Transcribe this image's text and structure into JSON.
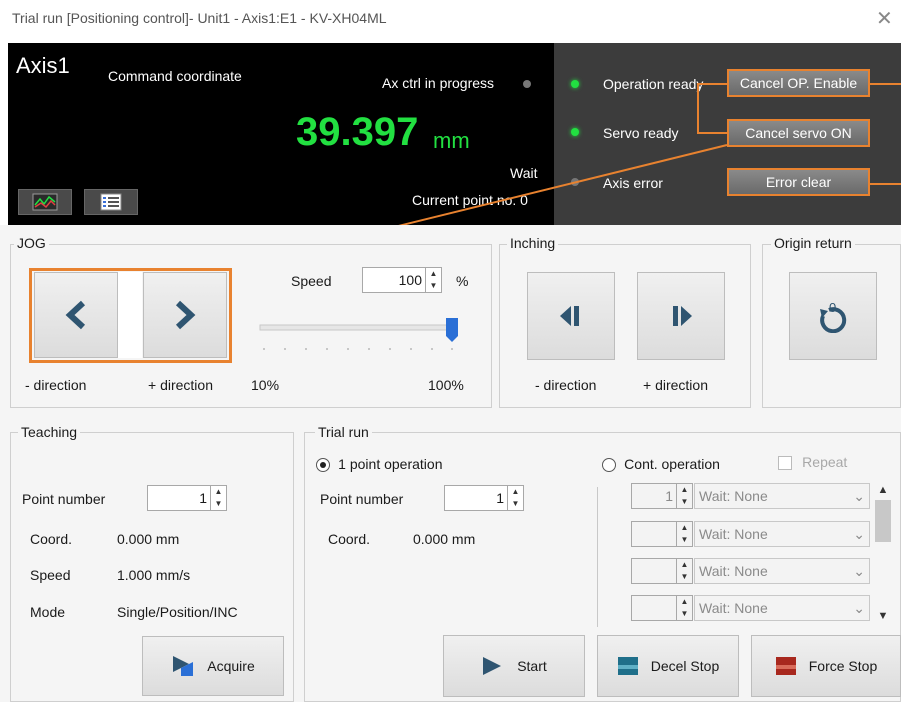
{
  "window": {
    "title": "Trial run [Positioning control]- Unit1 - Axis1:E1 - KV-XH04ML",
    "close_icon": "close-icon"
  },
  "status": {
    "axis_name": "Axis1",
    "coord_label": "Command coordinate",
    "ax_ctrl": "Ax ctrl in progress",
    "coord_value": "39.397",
    "coord_unit": "mm",
    "wait": "Wait",
    "current_point": "Current point no. 0",
    "operation_ready": "Operation ready",
    "servo_ready": "Servo ready",
    "axis_error": "Axis error",
    "cancel_op_enable": "Cancel OP. Enable",
    "cancel_servo_on": "Cancel servo ON",
    "error_clear": "Error clear",
    "accent_green": "#22e041",
    "highlight_orange": "#e8822f"
  },
  "jog": {
    "title": "JOG",
    "speed_label": "Speed",
    "speed_value": "100",
    "speed_unit": "%",
    "minus_dir": "- direction",
    "plus_dir": "+ direction",
    "min_pct": "10%",
    "max_pct": "100%",
    "slider_level": 1.0
  },
  "inching": {
    "title": "Inching",
    "minus_dir": "- direction",
    "plus_dir": "+ direction"
  },
  "origin": {
    "title": "Origin return"
  },
  "teaching": {
    "title": "Teaching",
    "point_number_label": "Point number",
    "point_number_value": "1",
    "coord_label": "Coord.",
    "coord_value": "0.000 mm",
    "speed_label": "Speed",
    "speed_value": "1.000 mm/s",
    "mode_label": "Mode",
    "mode_value": "Single/Position/INC",
    "acquire": "Acquire"
  },
  "trial": {
    "title": "Trial run",
    "one_point": "1 point operation",
    "cont_operation": "Cont. operation",
    "repeat": "Repeat",
    "point_number_label": "Point number",
    "point_number_value": "1",
    "coord_label": "Coord.",
    "coord_value": "0.000 mm",
    "rows": [
      {
        "num": "1",
        "wait": "Wait: None"
      },
      {
        "num": "",
        "wait": "Wait: None"
      },
      {
        "num": "",
        "wait": "Wait: None"
      },
      {
        "num": "",
        "wait": "Wait: None"
      }
    ],
    "start": "Start",
    "decel_stop": "Decel Stop",
    "force_stop": "Force Stop"
  }
}
